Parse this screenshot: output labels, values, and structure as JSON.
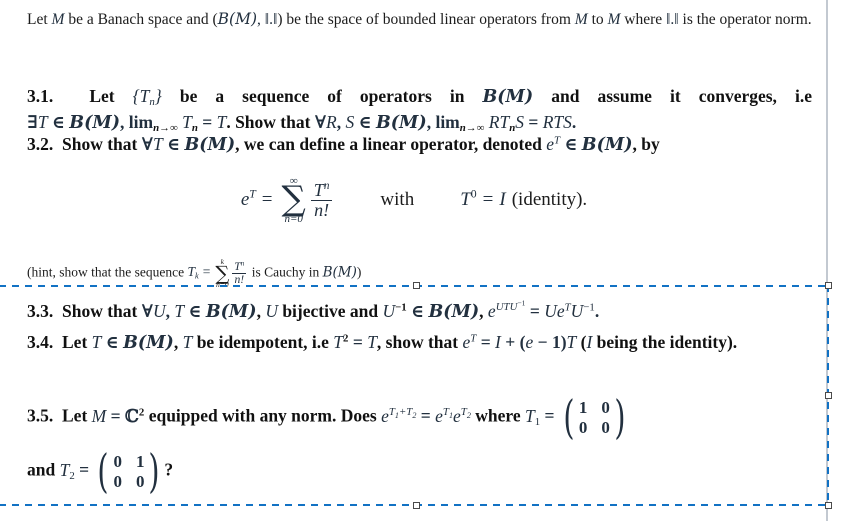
{
  "document": {
    "type": "math-exercise-sheet",
    "intro": {
      "prefix": "Let ",
      "sym_M": "M",
      "mid1": " be a Banach space and (",
      "sym_BM": "B(M)",
      "comma": ", ",
      "sym_norm": "‖.‖",
      "mid2": ") be the space of bounded linear operators from ",
      "sym_M2": "M",
      "mid3": " to ",
      "sym_M3": "M",
      "mid4": " where ",
      "sym_norm2": "‖.‖",
      "suffix": " is the operator norm.",
      "plain_text": "Let M be a Banach space and (B(M),‖.‖) be the space of bounded linear operators from M to M where ‖.‖ is the operator norm."
    },
    "items": [
      {
        "number": "3.1.",
        "text": "Let {T_n} be a sequence of operators in B(M) and assume it converges, i.e ∃T ∈ B(M), lim_{n→∞} T_n = T. Show that ∀R, S ∈ B(M), lim_{n→∞} RT_nS = RTS.",
        "parts": {
          "lead": "Let ",
          "seq": "{T_n}",
          "a": " be a sequence of operators in ",
          "bm": "B(M)",
          "b": " and assume it converges, i.e",
          "exists": "∃T ∈ B(M), lim",
          "limsub": "n→∞",
          "c": "T_n = T",
          "d": ". Show that ",
          "forall": "∀R, S ∈ B(M), lim",
          "e": "RT_nS = RTS."
        }
      },
      {
        "number": "3.2.",
        "text": "Show that ∀T ∈ B(M), we can define a linear operator, denoted e^T ∈ B(M), by",
        "parts": {
          "lead": "Show that ",
          "forall": "∀T ∈ B(M)",
          "a": ", we can define a linear operator, denoted ",
          "eT": "e^T",
          "b": " ∈ ",
          "bm": "B(M)",
          "c": ", by"
        }
      },
      {
        "number": "3.3.",
        "text": "Show that ∀U, T ∈ B(M), U bijective and U⁻¹ ∈ B(M), e^{UTU⁻¹} = Ue^TU⁻¹.",
        "parts": {
          "lead": "Show that ",
          "forall": "∀U, T ∈ B(M)",
          "a": ", ",
          "U": "U",
          "b": " bijective and ",
          "Uinv": "U⁻¹ ∈ B(M)",
          "c": ", ",
          "eq": "e^{UTU⁻¹} = Ue^TU⁻¹",
          "d": "."
        }
      },
      {
        "number": "3.4.",
        "text": "Let T ∈ B(M), T be idempotent, i.e T² = T, show that e^T = I + (e − 1)T (I being the identity).",
        "parts": {
          "lead": "Let ",
          "TB": "T ∈ B(M)",
          "a": ", ",
          "T": "T",
          "b": " be idempotent, i.e ",
          "idem": "T² = T",
          "c": ", show that ",
          "eq": "e^T = I + (e − 1)T",
          "d": " (",
          "I": "I",
          "e": " being the identity)."
        }
      },
      {
        "number": "3.5.",
        "text": "Let M = ℂ² equipped with any norm. Does e^{T₁+T₂} = e^{T₁}e^{T₂} where T₁ = (1 0; 0 0) and T₂ = (0 1; 0 0)?",
        "parts": {
          "lead": "Let ",
          "MC2": "M = ℂ²",
          "a": " equipped with any norm. Does ",
          "eq": "e^{T₁+T₂} = e^{T₁}e^{T₂}",
          "b": " where ",
          "T1": "T₁",
          "eqs": " = ",
          "and": "and ",
          "T2": "T₂",
          "qmark": "?"
        }
      }
    ],
    "display_equation": {
      "lhs_base": "e",
      "lhs_exp": "T",
      "equals": "=",
      "sum_symbol": "∑",
      "sum_upper": "∞",
      "sum_lower": "n=0",
      "frac_num_base": "T",
      "frac_num_exp": "n",
      "frac_den": "n!",
      "with_label": "with",
      "rhs_base": "T",
      "rhs_exp": "0",
      "rhs_equals": "=",
      "rhs_I": "I",
      "rhs_note": "(identity).",
      "plain_text": "e^T = ∑_{n=0}^{∞} T^n/n!   with   T^0 = I (identity)."
    },
    "hint": {
      "open": "(hint, show that the sequence ",
      "Tk": "T",
      "Tk_sub": "k",
      "equals": "=",
      "sum_symbol": "∑",
      "sum_upper": "k",
      "sum_lower": "n=0",
      "frac_num_base": "T",
      "frac_num_exp": "n",
      "frac_den": "n!",
      "close": " is Cauchy in ",
      "bm": "B(M)",
      "close2": ")",
      "plain_text": "(hint, show that the sequence T_k = ∑_{n=0}^{k} T^n/n! is Cauchy in B(M))"
    },
    "matrices": {
      "T1": {
        "label": "T₁",
        "rows": [
          [
            "1",
            "0"
          ],
          [
            "0",
            "0"
          ]
        ]
      },
      "T2": {
        "label": "T₂",
        "rows": [
          [
            "0",
            "1"
          ],
          [
            "0",
            "0"
          ]
        ]
      },
      "left_paren": "⎛",
      "right_paren": "⎞"
    }
  },
  "overlay": {
    "selection": {
      "name": "dashed-selection-box",
      "color": "#1272c4",
      "handle_fill": "#ffffff",
      "handle_border": "#4a4a4a",
      "handles": [
        "top-middle",
        "top-right",
        "right-middle",
        "bottom-right",
        "bottom-middle"
      ]
    }
  },
  "colors": {
    "page_background": "#ffffff",
    "body_text": "#1c1c1c",
    "math_text": "#22303f",
    "page_border": "#c3c9d1",
    "selection_blue": "#1272c4"
  }
}
